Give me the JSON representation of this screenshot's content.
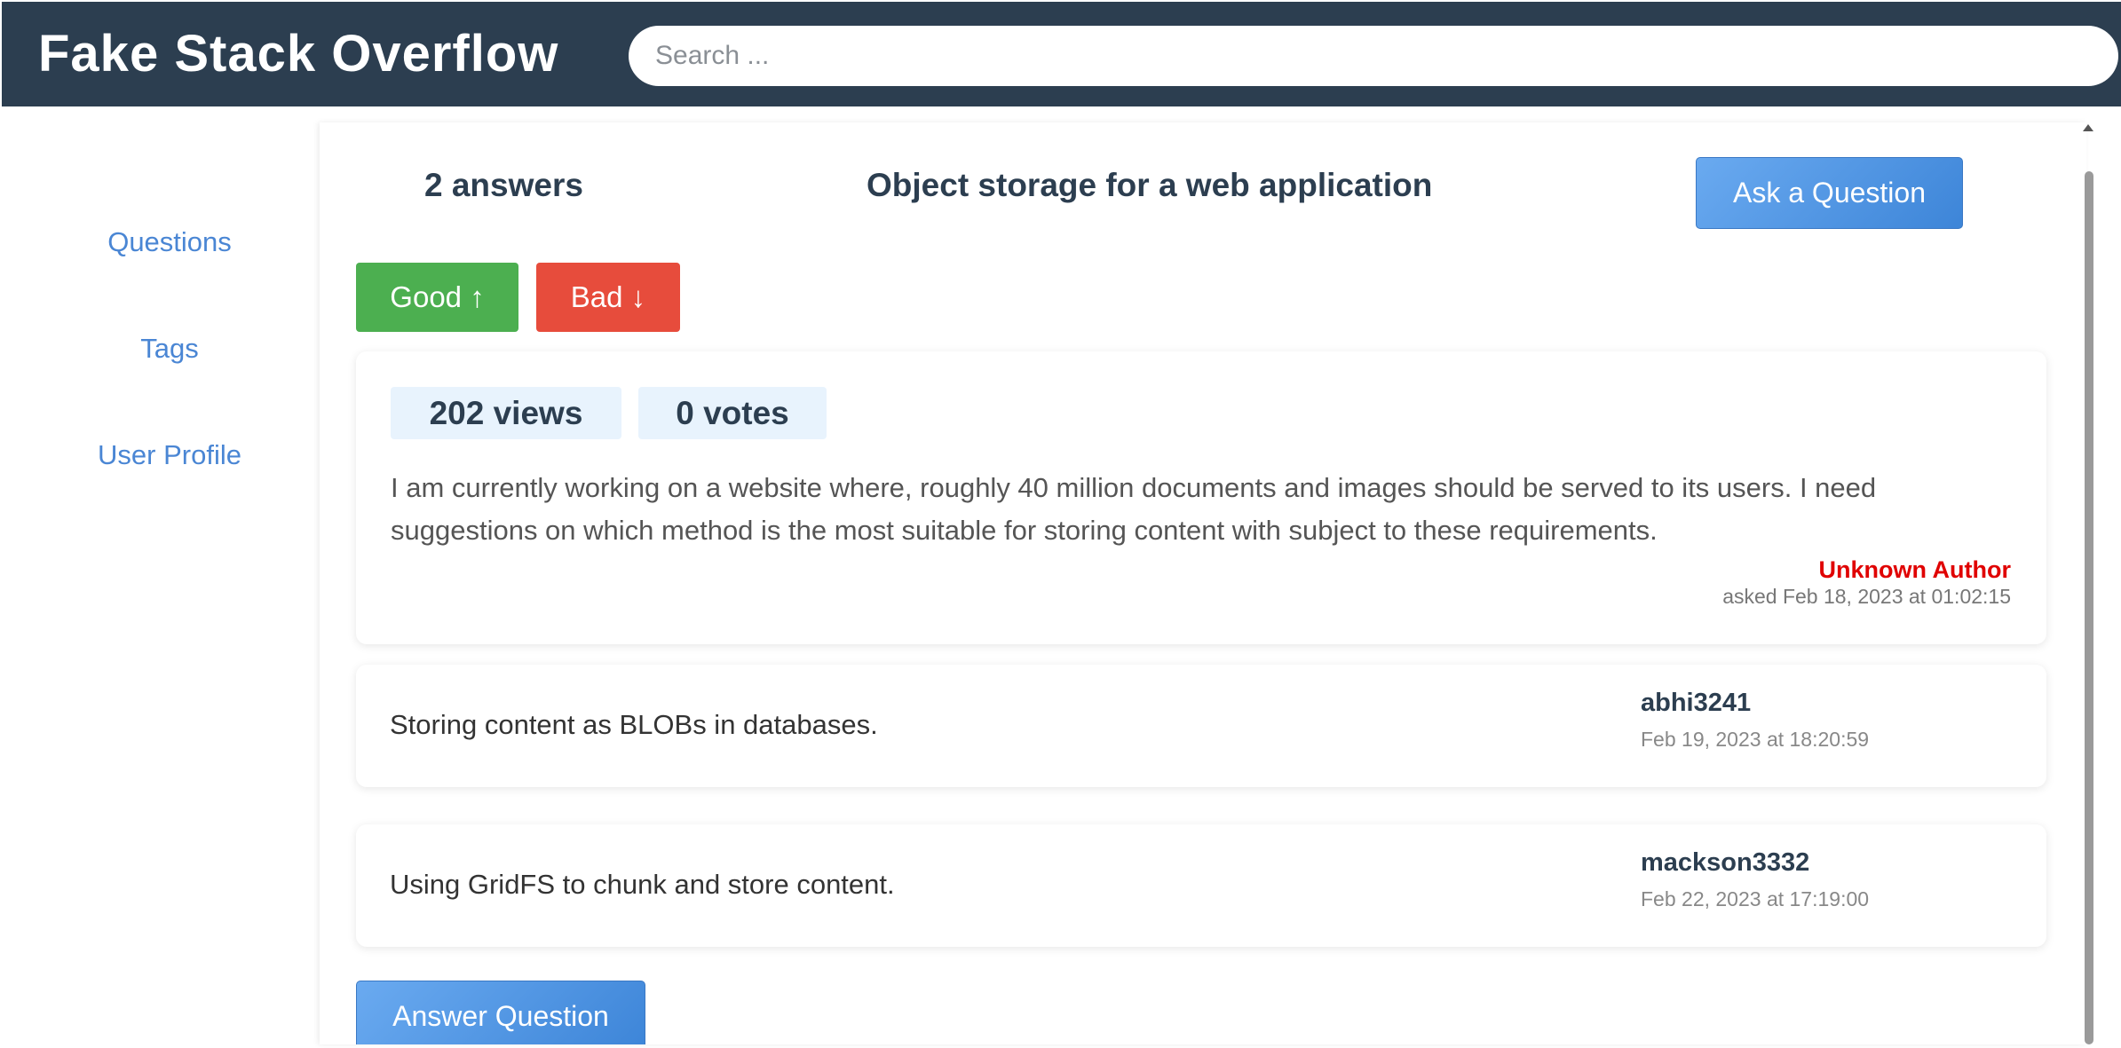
{
  "header": {
    "logo": "Fake Stack Overflow",
    "search_placeholder": "Search ..."
  },
  "sidebar": {
    "items": [
      {
        "label": "Questions"
      },
      {
        "label": "Tags"
      },
      {
        "label": "User Profile"
      }
    ]
  },
  "question": {
    "answers_count": "2 answers",
    "title": "Object storage for a web application",
    "ask_label": "Ask a Question",
    "good_label": "Good ↑",
    "bad_label": "Bad ↓",
    "views": "202 views",
    "votes": "0 votes",
    "text": "I am currently working on a website where, roughly 40 million documents and images should be served to its users. I need suggestions on which method is the most suitable for storing content with subject to these requirements.",
    "author": "Unknown Author",
    "asked": "asked Feb 18, 2023 at 01:02:15"
  },
  "answers": [
    {
      "text": "Storing content as BLOBs in databases.",
      "author": "abhi3241",
      "date": "Feb 19, 2023 at 18:20:59"
    },
    {
      "text": "Using GridFS to chunk and store content.",
      "author": "mackson3332",
      "date": "Feb 22, 2023 at 17:19:00"
    }
  ],
  "answer_button_label": "Answer Question",
  "colors": {
    "header_bg": "#2c3e50",
    "link": "#4a86d4",
    "good": "#4caf50",
    "bad": "#e74c3c",
    "primary": "#3d85d8",
    "author_unknown": "#e00000"
  }
}
